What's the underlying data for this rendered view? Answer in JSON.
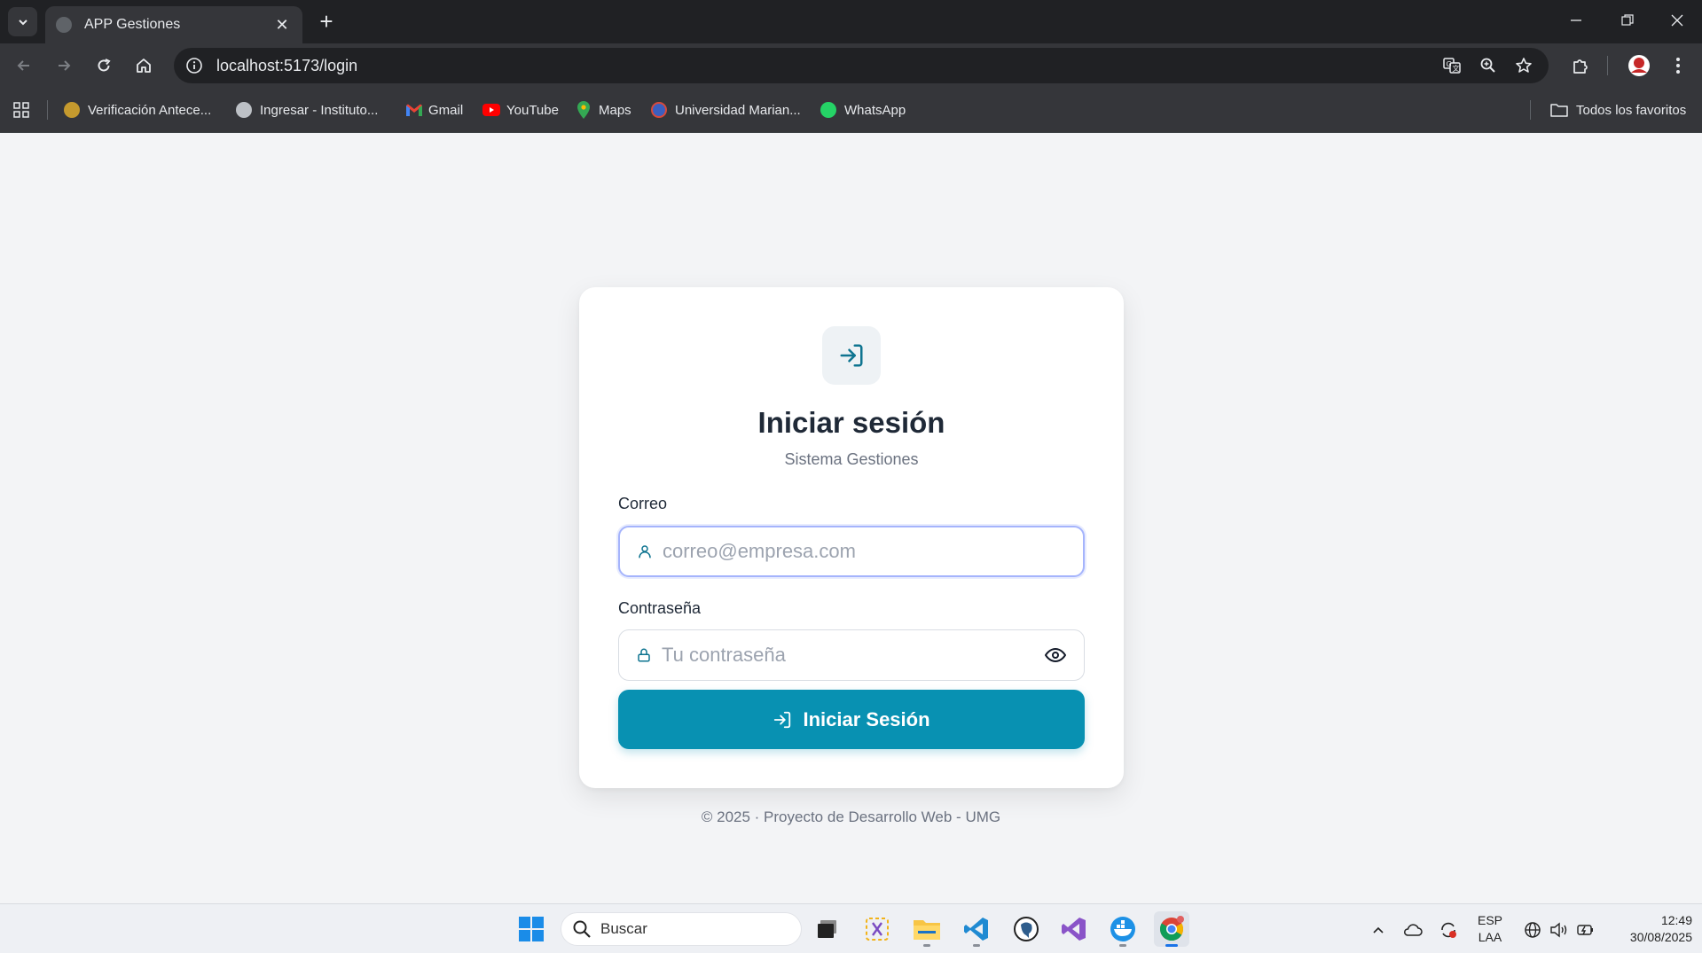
{
  "browser": {
    "tab_title": "APP Gestiones",
    "url": "localhost:5173/login",
    "bookmarks": [
      "Verificación Antece...",
      "Ingresar - Instituto...",
      "Gmail",
      "YouTube",
      "Maps",
      "Universidad Marian...",
      "WhatsApp"
    ],
    "all_bookmarks": "Todos los favoritos"
  },
  "login": {
    "title": "Iniciar sesión",
    "subtitle": "Sistema Gestiones",
    "email_label": "Correo",
    "email_placeholder": "correo@empresa.com",
    "password_label": "Contraseña",
    "password_placeholder": "Tu contraseña",
    "submit_label": "Iniciar Sesión",
    "accent_color": "#0891b2"
  },
  "footer": {
    "text": "© 2025 · Proyecto de Desarrollo Web - UMG"
  },
  "taskbar": {
    "search_label": "Buscar",
    "lang_top": "ESP",
    "lang_bottom": "LAA",
    "time": "12:49",
    "date": "30/08/2025"
  }
}
